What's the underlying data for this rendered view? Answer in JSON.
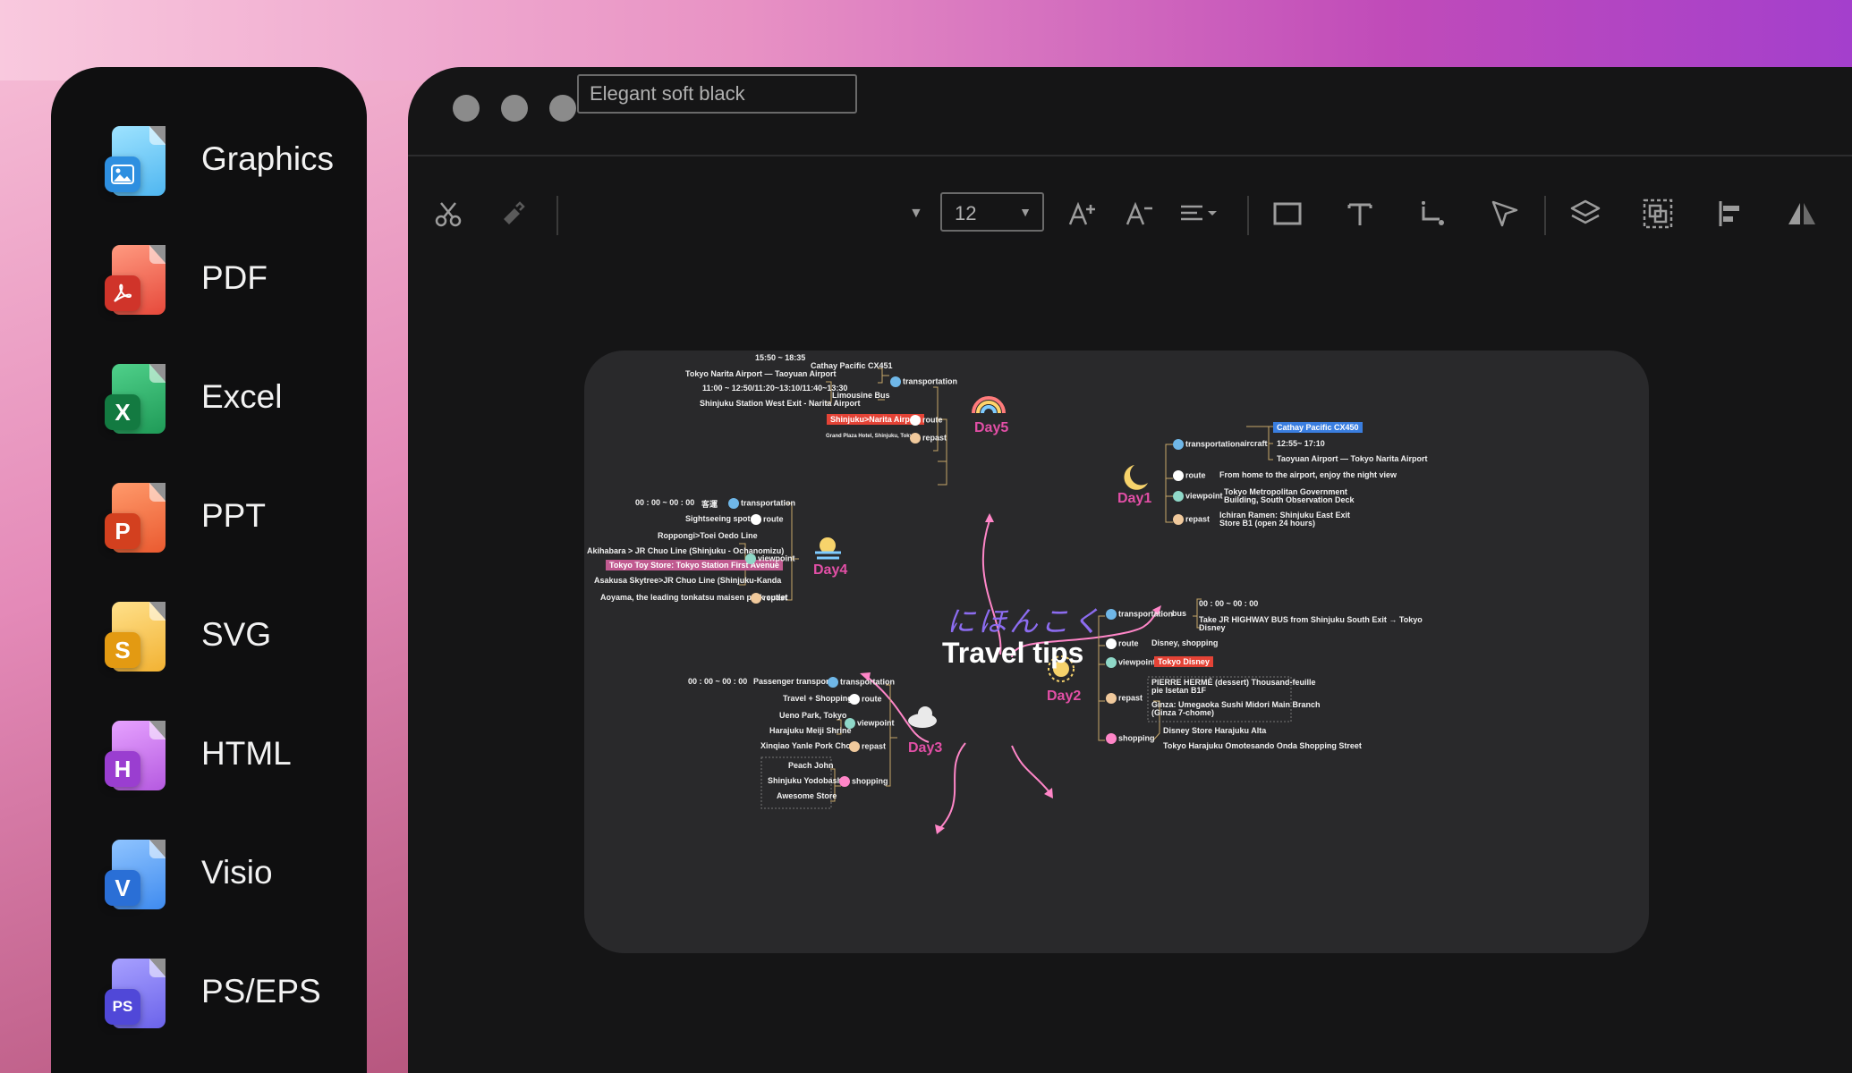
{
  "sidebar": {
    "items": [
      {
        "label": "Graphics",
        "icon": "image-file-icon",
        "color": "#4fb6f0",
        "badge": ""
      },
      {
        "label": "PDF",
        "icon": "pdf-file-icon",
        "color": "#e6493b",
        "badge": ""
      },
      {
        "label": "Excel",
        "icon": "excel-file-icon",
        "color": "#1f9a57",
        "badge": "X"
      },
      {
        "label": "PPT",
        "icon": "ppt-file-icon",
        "color": "#ea5a30",
        "badge": "P"
      },
      {
        "label": "SVG",
        "icon": "svg-file-icon",
        "color": "#f2b233",
        "badge": "S"
      },
      {
        "label": "HTML",
        "icon": "html-file-icon",
        "color": "#b55ae0",
        "badge": "H"
      },
      {
        "label": "Visio",
        "icon": "visio-file-icon",
        "color": "#3f8bef",
        "badge": "V"
      },
      {
        "label": "PS/EPS",
        "icon": "ps-eps-file-icon",
        "color": "#6b63ea",
        "badge": "PS"
      }
    ]
  },
  "toolbar": {
    "theme_value": "Elegant soft black",
    "font_size": "12"
  },
  "mindmap": {
    "center_jp": "にほんこく",
    "center_title": "Travel tips",
    "days": [
      "Day5",
      "Day1",
      "Day4",
      "Day2",
      "Day3"
    ],
    "day5": {
      "time1": "15:50 ~ 18:35",
      "flight": "Cathay Pacific CX451",
      "airports": "Tokyo Narita Airport — Taoyuan Airport",
      "times2": "11:00 ~ 12:50/11:20~13:10/11:40~13:30",
      "bus": "Limousine Bus",
      "bus_stop": "Shinjuku Station West Exit - Narita Airport",
      "transportation": "transportation",
      "route_tag": "Shinjuku>Narita Airport",
      "route": "route",
      "hotel": "Grand Plaza Hotel, Shinjuku, Tokyo",
      "repast": "repast"
    },
    "day1": {
      "transportation": "transportation",
      "aircraft": "aircraft",
      "flight": "Cathay Pacific CX450",
      "time": "12:55~ 17:10",
      "airports": "Taoyuan Airport — Tokyo Narita Airport",
      "route": "route",
      "route_text": "From home to the airport, enjoy the night view",
      "viewpoint": "viewpoint",
      "viewpoint_text1": "Tokyo Metropolitan Government",
      "viewpoint_text2": "Building, South Observation Deck",
      "repast": "repast",
      "repast_text1": "Ichiran Ramen: Shinjuku East Exit",
      "repast_text2": "Store B1 (open 24 hours)"
    },
    "day4": {
      "time": "00 : 00 ~ 00 : 00",
      "tag": "客運",
      "transportation": "transportation",
      "sightseeing": "Sightseeing spots",
      "route": "route",
      "line1": "Roppongi>Toei Oedo Line",
      "line2": "Akihabara > JR Chuo Line (Shinjuku - Ochanomizu)",
      "line3": "Tokyo Toy Store: Tokyo Station First Avenue",
      "line4": "Asakusa Skytree>JR Chuo Line (Shinjuku-Kanda",
      "viewpoint": "viewpoint",
      "food": "Aoyama, the leading tonkatsu maisen pork cutlet",
      "repast": "repast"
    },
    "day2": {
      "transportation": "transportation",
      "bus": "bus",
      "time": "00 : 00 ~ 00 : 00",
      "bus_text1": "Take JR HIGHWAY BUS from Shinjuku South Exit → Tokyo",
      "bus_text2": "Disney",
      "route": "route",
      "route_text": "Disney, shopping",
      "viewpoint": "viewpoint",
      "viewpoint_tag": "Tokyo Disney",
      "repast": "repast",
      "repast_text1": "PIERRE HERMÉ (dessert) Thousand-feuille",
      "repast_text2": "pie Isetan B1F",
      "repast_text3": "Ginza: Umegaoka Sushi Midori Main Branch",
      "repast_text4": "(Ginza 7-chome)",
      "shopping": "shopping",
      "shop1": "Disney Store Harajuku Alta",
      "shop2": "Tokyo Harajuku Omotesando Onda Shopping Street"
    },
    "day3": {
      "time": "00 : 00 ~ 00 : 00",
      "passenger": "Passenger transport",
      "transportation": "transportation",
      "travel": "Travel + Shopping",
      "route": "route",
      "park": "Ueno Park, Tokyo",
      "shrine": "Harajuku Meiji Shrine",
      "viewpoint": "viewpoint",
      "food": "Xinqiao Yanle Pork Chops",
      "repast": "repast",
      "shop1": "Peach John",
      "shop2": "Shinjuku Yodobashi",
      "shop3": "Awesome Store",
      "shopping": "shopping"
    }
  },
  "colors": {
    "accent_pink": "#e24fa6",
    "branch_line": "#ff86c8",
    "canvas_bg": "#29292b"
  }
}
